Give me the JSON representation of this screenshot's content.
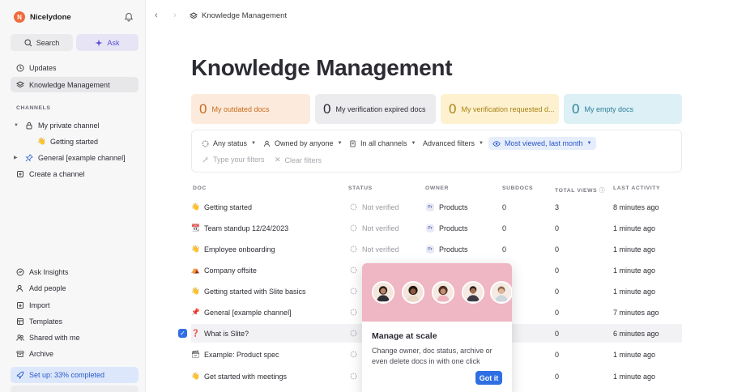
{
  "workspace": {
    "name": "Nicelydone",
    "logo_letter": "N"
  },
  "sidebar": {
    "search_label": "Search",
    "ask_label": "Ask",
    "updates": "Updates",
    "knowledge": "Knowledge Management",
    "channels_heading": "CHANNELS",
    "channels": [
      {
        "label": "My private channel"
      },
      {
        "label": "Getting started"
      },
      {
        "label": "General [example channel]"
      }
    ],
    "create_channel": "Create a channel",
    "bottom": [
      {
        "label": "Ask Insights"
      },
      {
        "label": "Add people"
      },
      {
        "label": "Import"
      },
      {
        "label": "Templates"
      },
      {
        "label": "Shared with me"
      },
      {
        "label": "Archive"
      }
    ],
    "setup_label": "Set up: 33% completed"
  },
  "breadcrumb": {
    "label": "Knowledge Management"
  },
  "page_title": "Knowledge Management",
  "stats": [
    {
      "num": "0",
      "label": "My outdated docs"
    },
    {
      "num": "0",
      "label": "My verification expired docs"
    },
    {
      "num": "0",
      "label": "My verification requested d..."
    },
    {
      "num": "0",
      "label": "My empty docs"
    }
  ],
  "filters": {
    "status": "Any status",
    "owner": "Owned by anyone",
    "channels": "In all channels",
    "advanced": "Advanced filters",
    "sort": "Most viewed, last month",
    "type_placeholder": "Type your filters",
    "clear": "Clear filters"
  },
  "table": {
    "headers": {
      "doc": "DOC",
      "status": "STATUS",
      "owner": "OWNER",
      "subdocs": "SUBDOCS",
      "views": "TOTAL VIEWS",
      "activity": "LAST ACTIVITY"
    },
    "rows": [
      {
        "emoji": "👋",
        "doc": "Getting started",
        "status": "Not verified",
        "owner": "Products",
        "subdocs": "0",
        "views": "3",
        "activity": "8 minutes ago"
      },
      {
        "emoji": "📆",
        "doc": "Team standup 12/24/2023",
        "status": "Not verified",
        "owner": "Products",
        "subdocs": "0",
        "views": "0",
        "activity": "1 minute ago"
      },
      {
        "emoji": "👋",
        "doc": "Employee onboarding",
        "status": "Not verified",
        "owner": "Products",
        "subdocs": "0",
        "views": "0",
        "activity": "1 minute ago"
      },
      {
        "emoji": "⛺",
        "doc": "Company offsite",
        "status": "",
        "owner": "",
        "subdocs": "",
        "views": "0",
        "activity": "1 minute ago"
      },
      {
        "emoji": "👋",
        "doc": "Getting started with Slite basics",
        "status": "",
        "owner": "",
        "subdocs": "",
        "views": "0",
        "activity": "1 minute ago"
      },
      {
        "emoji": "📌",
        "doc": "General [example channel]",
        "status": "",
        "owner": "",
        "subdocs": "",
        "views": "0",
        "activity": "7 minutes ago"
      },
      {
        "emoji": "❓",
        "doc": "What is Slite?",
        "status": "",
        "owner": "",
        "subdocs": "",
        "views": "0",
        "activity": "6 minutes ago"
      },
      {
        "emoji": "🗃",
        "doc": "Example: Product spec",
        "status": "",
        "owner": "",
        "subdocs": "",
        "views": "0",
        "activity": "1 minute ago"
      },
      {
        "emoji": "👋",
        "doc": "Get started with meetings",
        "status": "",
        "owner": "",
        "subdocs": "",
        "views": "0",
        "activity": "1 minute ago"
      }
    ]
  },
  "popup": {
    "title": "Manage at scale",
    "body": "Change owner, doc status, archive or even delete docs in with one click",
    "button": "Got it"
  },
  "colors": {
    "accent": "#2f6fe3",
    "brand": "#ef6a3a",
    "ask": "#5b4fd6",
    "popup_hero": "#efb6c3"
  }
}
